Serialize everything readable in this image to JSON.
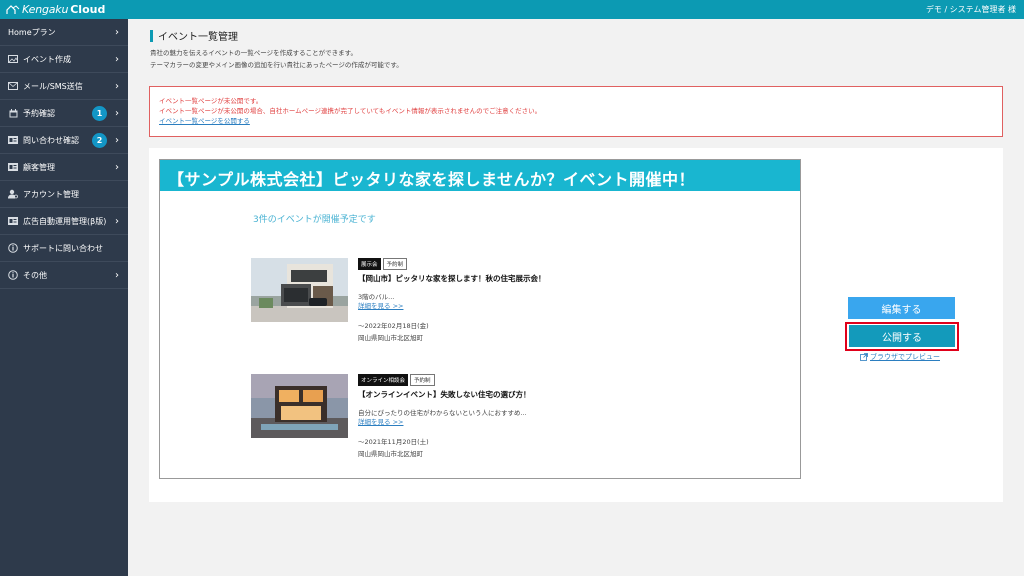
{
  "header": {
    "logo_text_1": "Kengaku",
    "logo_text_2": "Cloud",
    "user": "デモ / システム管理者 様"
  },
  "sidebar": {
    "items": [
      {
        "label": "Homeプラン",
        "icon": "",
        "badge": "",
        "chevron": true
      },
      {
        "label": "イベント作成",
        "icon": "image-icon",
        "badge": "",
        "chevron": true
      },
      {
        "label": "メール/SMS送信",
        "icon": "mail-icon",
        "badge": "",
        "chevron": true
      },
      {
        "label": "予約確認",
        "icon": "calendar-icon",
        "badge": "1",
        "chevron": true
      },
      {
        "label": "問い合わせ確認",
        "icon": "id-card-icon",
        "badge": "2",
        "chevron": true
      },
      {
        "label": "顧客管理",
        "icon": "id-card-icon",
        "badge": "",
        "chevron": true
      },
      {
        "label": "アカウント管理",
        "icon": "user-cog-icon",
        "badge": "",
        "chevron": false
      },
      {
        "label": "広告自動運用管理(β版)",
        "icon": "id-card-icon",
        "badge": "",
        "chevron": true
      },
      {
        "label": "サポートに問い合わせ",
        "icon": "info-icon",
        "badge": "",
        "chevron": false
      },
      {
        "label": "その他",
        "icon": "info-icon",
        "badge": "",
        "chevron": true
      }
    ],
    "chevron_glyph": "›"
  },
  "main": {
    "title": "イベント一覧管理",
    "desc_1": "貴社の魅力を伝えるイベントの一覧ページを作成することができます。",
    "desc_2": "テーマカラーの変更やメイン画像の追加を行い貴社にあったページの作成が可能です。",
    "alert": {
      "line_1": "イベント一覧ページが未公開です。",
      "line_2": "イベント一覧ページが未公開の場合、自社ホームページ連携が完了していてもイベント情報が表示されませんのでご注意ください。",
      "link": "イベント一覧ページを公開する"
    },
    "preview": {
      "header": "【サンプル株式会社】ピッタリな家を探しませんか？イベント開催中！",
      "count": "3件のイベントが開催予定です",
      "events": [
        {
          "tag_1": "展示会",
          "tag_2": "予約制",
          "title": "【岡山市】ピッタリな家を探します！秋の住宅展示会！",
          "desc": "3階のバル...",
          "link": "詳細を見る >>",
          "date": "～2022年02月18日(金)",
          "place": "岡山県岡山市北区旭町"
        },
        {
          "tag_1": "オンライン相談会",
          "tag_2": "予約制",
          "title": "【オンラインイベント】失敗しない住宅の選び方！",
          "desc": "自分にぴったりの住宅がわからないという人におすすめ...",
          "link": "詳細を見る >>",
          "date": "～2021年11月20日(土)",
          "place": "岡山県岡山市北区旭町"
        }
      ]
    },
    "buttons": {
      "edit": "編集する",
      "publish": "公開する",
      "preview": "ブラウザでプレビュー"
    }
  },
  "colors": {
    "topbar": "#0c9ab3",
    "sidebar": "#2e3a4b",
    "badge": "#1396c6",
    "preview_header": "#19b6d0",
    "edit_button": "#39a6ee",
    "publish_button": "#139abb",
    "highlight": "#e0001a"
  }
}
